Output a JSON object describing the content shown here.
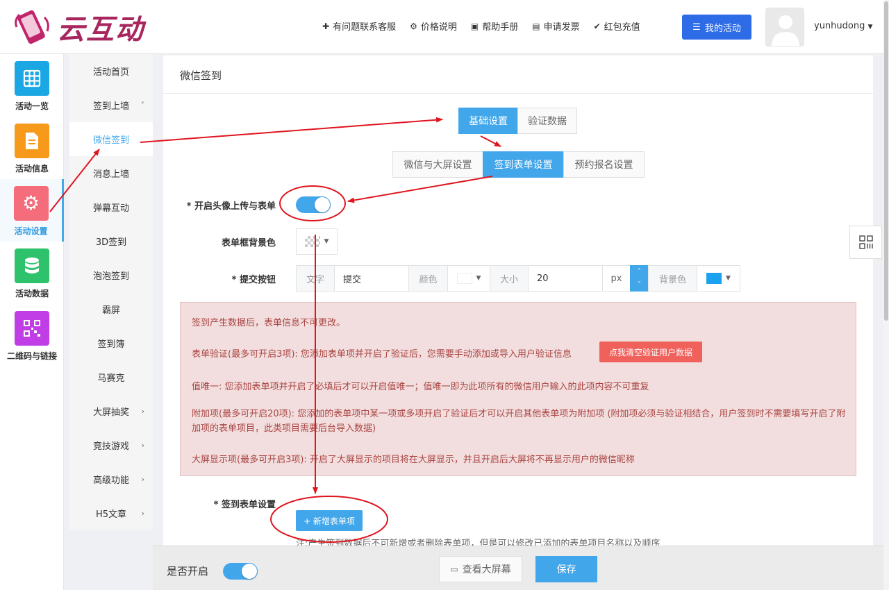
{
  "header": {
    "logo_text": "云互动",
    "nav": [
      {
        "label": "有问题联系客服",
        "icon": "user-plus-icon"
      },
      {
        "label": "价格说明",
        "icon": "gear-icon"
      },
      {
        "label": "帮助手册",
        "icon": "book-icon"
      },
      {
        "label": "申请发票",
        "icon": "printer-icon"
      },
      {
        "label": "红包充值",
        "icon": "shield-check-icon"
      }
    ],
    "my_activity": "我的活动",
    "username": "yunhudong"
  },
  "iconbar": [
    {
      "label": "活动一览",
      "icon": "grid-icon",
      "color": "#1aa7e4"
    },
    {
      "label": "活动信息",
      "icon": "document-icon",
      "color": "#f79a1c"
    },
    {
      "label": "活动设置",
      "icon": "gear-icon",
      "color": "#f56c7b"
    },
    {
      "label": "活动数据",
      "icon": "database-icon",
      "color": "#2dc26b"
    },
    {
      "label": "二维码与链接",
      "icon": "qrcode-icon",
      "color": "#c13ee6"
    }
  ],
  "submenu": [
    "活动首页",
    "签到上墙",
    "微信签到",
    "消息上墙",
    "弹幕互动",
    "3D签到",
    "泡泡签到",
    "霸屏",
    "签到簿",
    "马赛克",
    "大屏抽奖",
    "竞技游戏",
    "高级功能",
    "H5文章"
  ],
  "card": {
    "title": "微信签到",
    "tabs_top": [
      "基础设置",
      "验证数据"
    ],
    "tabs_sub": [
      "微信与大屏设置",
      "签到表单设置",
      "预约报名设置"
    ]
  },
  "form": {
    "avatar_label": "* 开启头像上传与表单",
    "bg_label": "表单框背景色",
    "submit_label": "* 提交按钮",
    "text_addon": "文字",
    "text_value": "提交",
    "color_addon": "颜色",
    "size_addon": "大小",
    "size_value": "20",
    "unit": "px",
    "bg_addon": "背景色",
    "bg_color": "#1aa2f1"
  },
  "alert": {
    "line1": "签到产生数据后，表单信息不可更改。",
    "line2": "表单验证(最多可开启3项): 您添加表单项并开启了验证后，您需要手动添加或导入用户验证信息",
    "clear_button": "点我清空验证用户数据",
    "line3": "值唯一: 您添加表单项并开启了必填后才可以开启值唯一；值唯一即为此项所有的微信用户输入的此项内容不可重复",
    "line4": "附加项(最多可开启20项): 您添加的表单项中某一项或多项开启了验证后才可以开启其他表单项为附加项 (附加项必须与验证相结合，用户签到时不需要填写开启了附加项的表单项目，此类项目需要后台导入数据)",
    "line5": "大屏显示项(最多可开启3项): 开启了大屏显示的项目将在大屏显示，并且开启后大屏将不再显示用户的微信昵称"
  },
  "signin_form": {
    "label": "* 签到表单设置",
    "add_button": "+ 新增表单项",
    "note": "注:产生签到数据后不可新增或者删除表单项，但是可以修改已添加的表单项目名称以及顺序"
  },
  "footer": {
    "enable_label": "是否开启",
    "view_button": "查看大屏幕",
    "save_button": "保存"
  },
  "colors": {
    "accent": "#42a6ea",
    "annotation": "#e0141e"
  }
}
